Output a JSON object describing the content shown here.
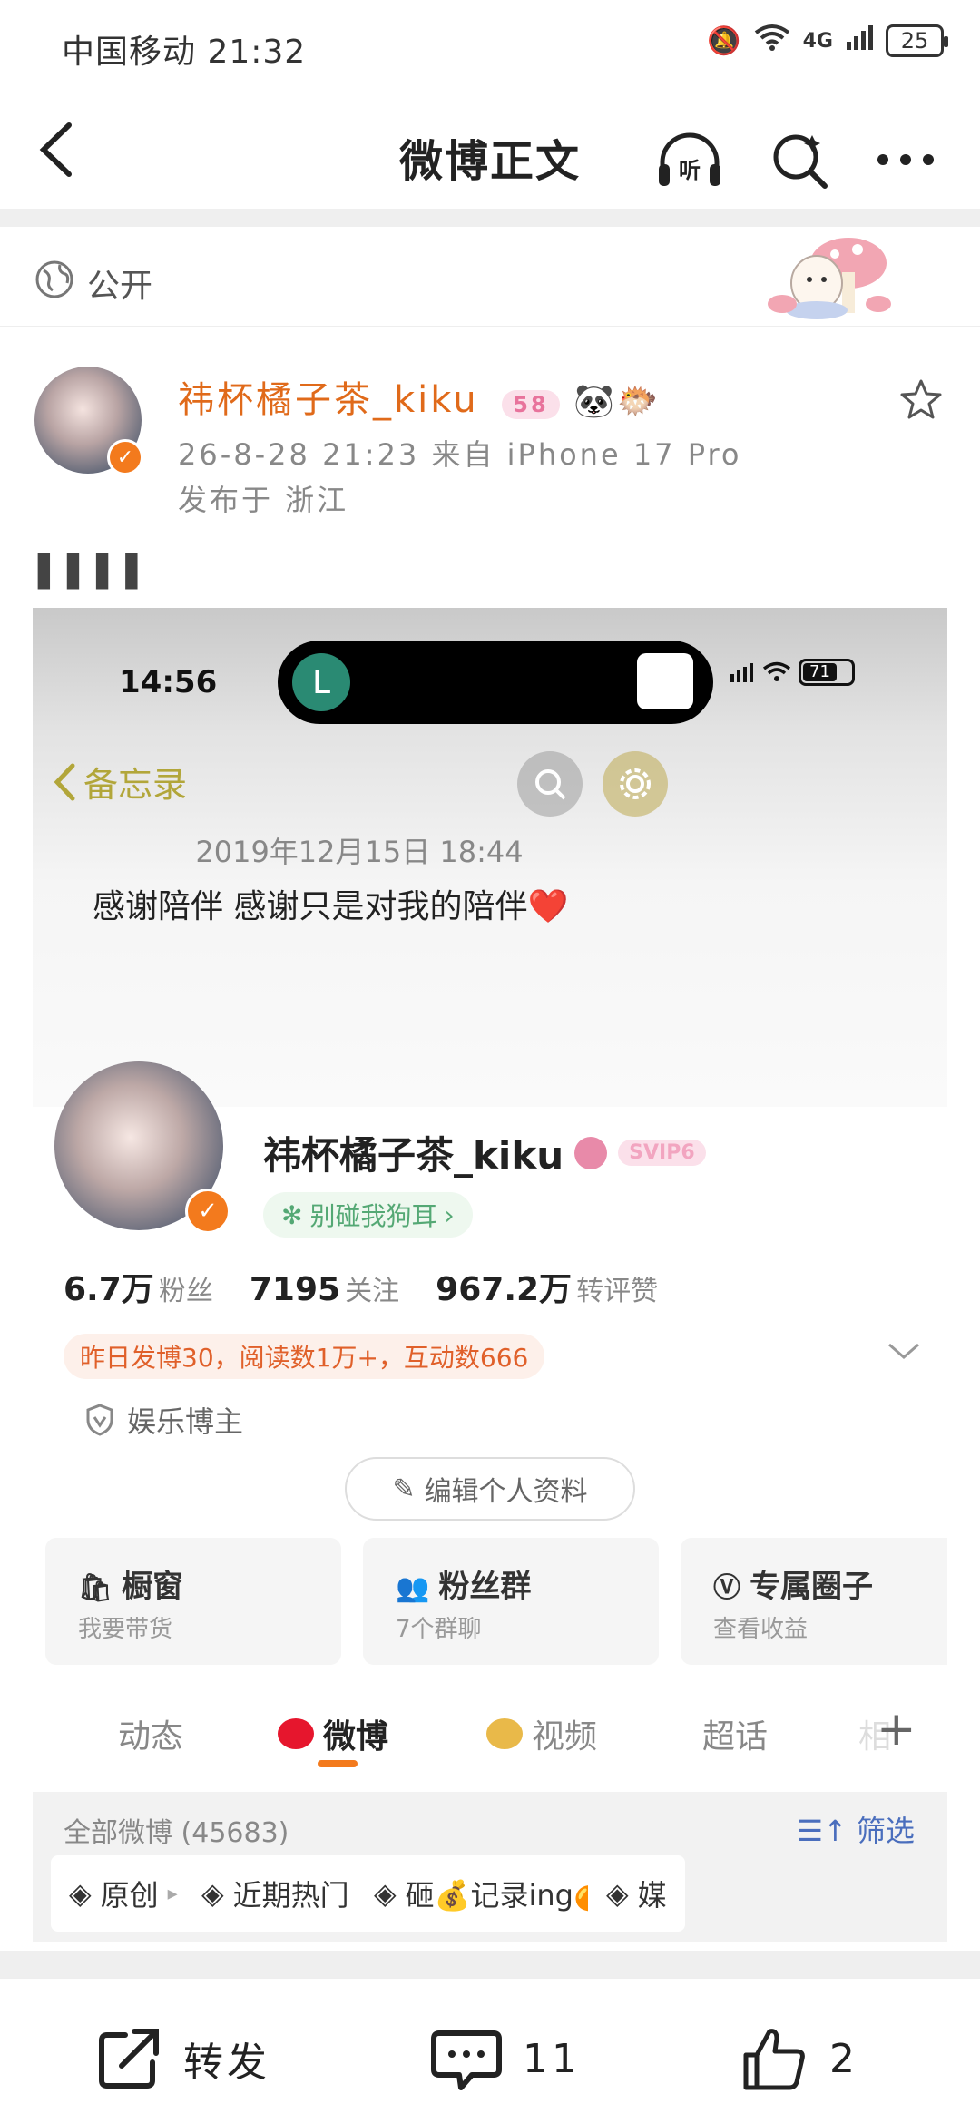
{
  "status_bar": {
    "carrier_time": "中国移动 21:32",
    "network": "4G",
    "battery": "25"
  },
  "nav": {
    "title": "微博正文"
  },
  "visibility": {
    "label": "公开"
  },
  "post": {
    "author_name": "祎杯橘子茶_kiku",
    "level_badge": "58",
    "emojis": "🐼🐡",
    "timestamp_source": "26-8-28 21:23  来自 iPhone 17 Pro",
    "location": "发布于 浙江",
    "body_text": "▌▌▌▌"
  },
  "screenshot": {
    "phone_time": "14:56",
    "phone_battery": "71",
    "memo_back_label": "备忘录",
    "memo_date": "2019年12月15日 18:44",
    "memo_text": "感谢陪伴 感谢只是对我的陪伴",
    "memo_heart": "❤️",
    "profile": {
      "name": "祎杯橘子茶_kiku",
      "svip_badge": "SVIP6",
      "status_pill": "别碰我狗耳",
      "stats": [
        {
          "value": "6.7万",
          "label": "粉丝"
        },
        {
          "value": "7195",
          "label": "关注"
        },
        {
          "value": "967.2万",
          "label": "转评赞"
        }
      ],
      "activity_banner": "昨日发博30，阅读数1万+，互动数666",
      "category": "娱乐博主",
      "edit_button": "编辑个人资料",
      "cards": [
        {
          "title": "橱窗",
          "sub": "我要带货"
        },
        {
          "title": "粉丝群",
          "sub": "7个群聊"
        },
        {
          "title": "专属圈子",
          "sub": "查看收益"
        }
      ],
      "tabs": [
        "动态",
        "微博",
        "视频",
        "超话",
        "相"
      ],
      "active_tab": "微博",
      "all_weibo": "全部微博 (45683)",
      "filter": "筛选",
      "chips": [
        "原创",
        "近期热门",
        "砸💰记录ing🍊",
        "媒"
      ]
    }
  },
  "actions": {
    "repost": "转发",
    "comments": "11",
    "likes": "2"
  },
  "colors": {
    "accent_orange": "#f37a1d",
    "author_orange": "#e06a1a",
    "link_blue": "#4a6ebd"
  }
}
